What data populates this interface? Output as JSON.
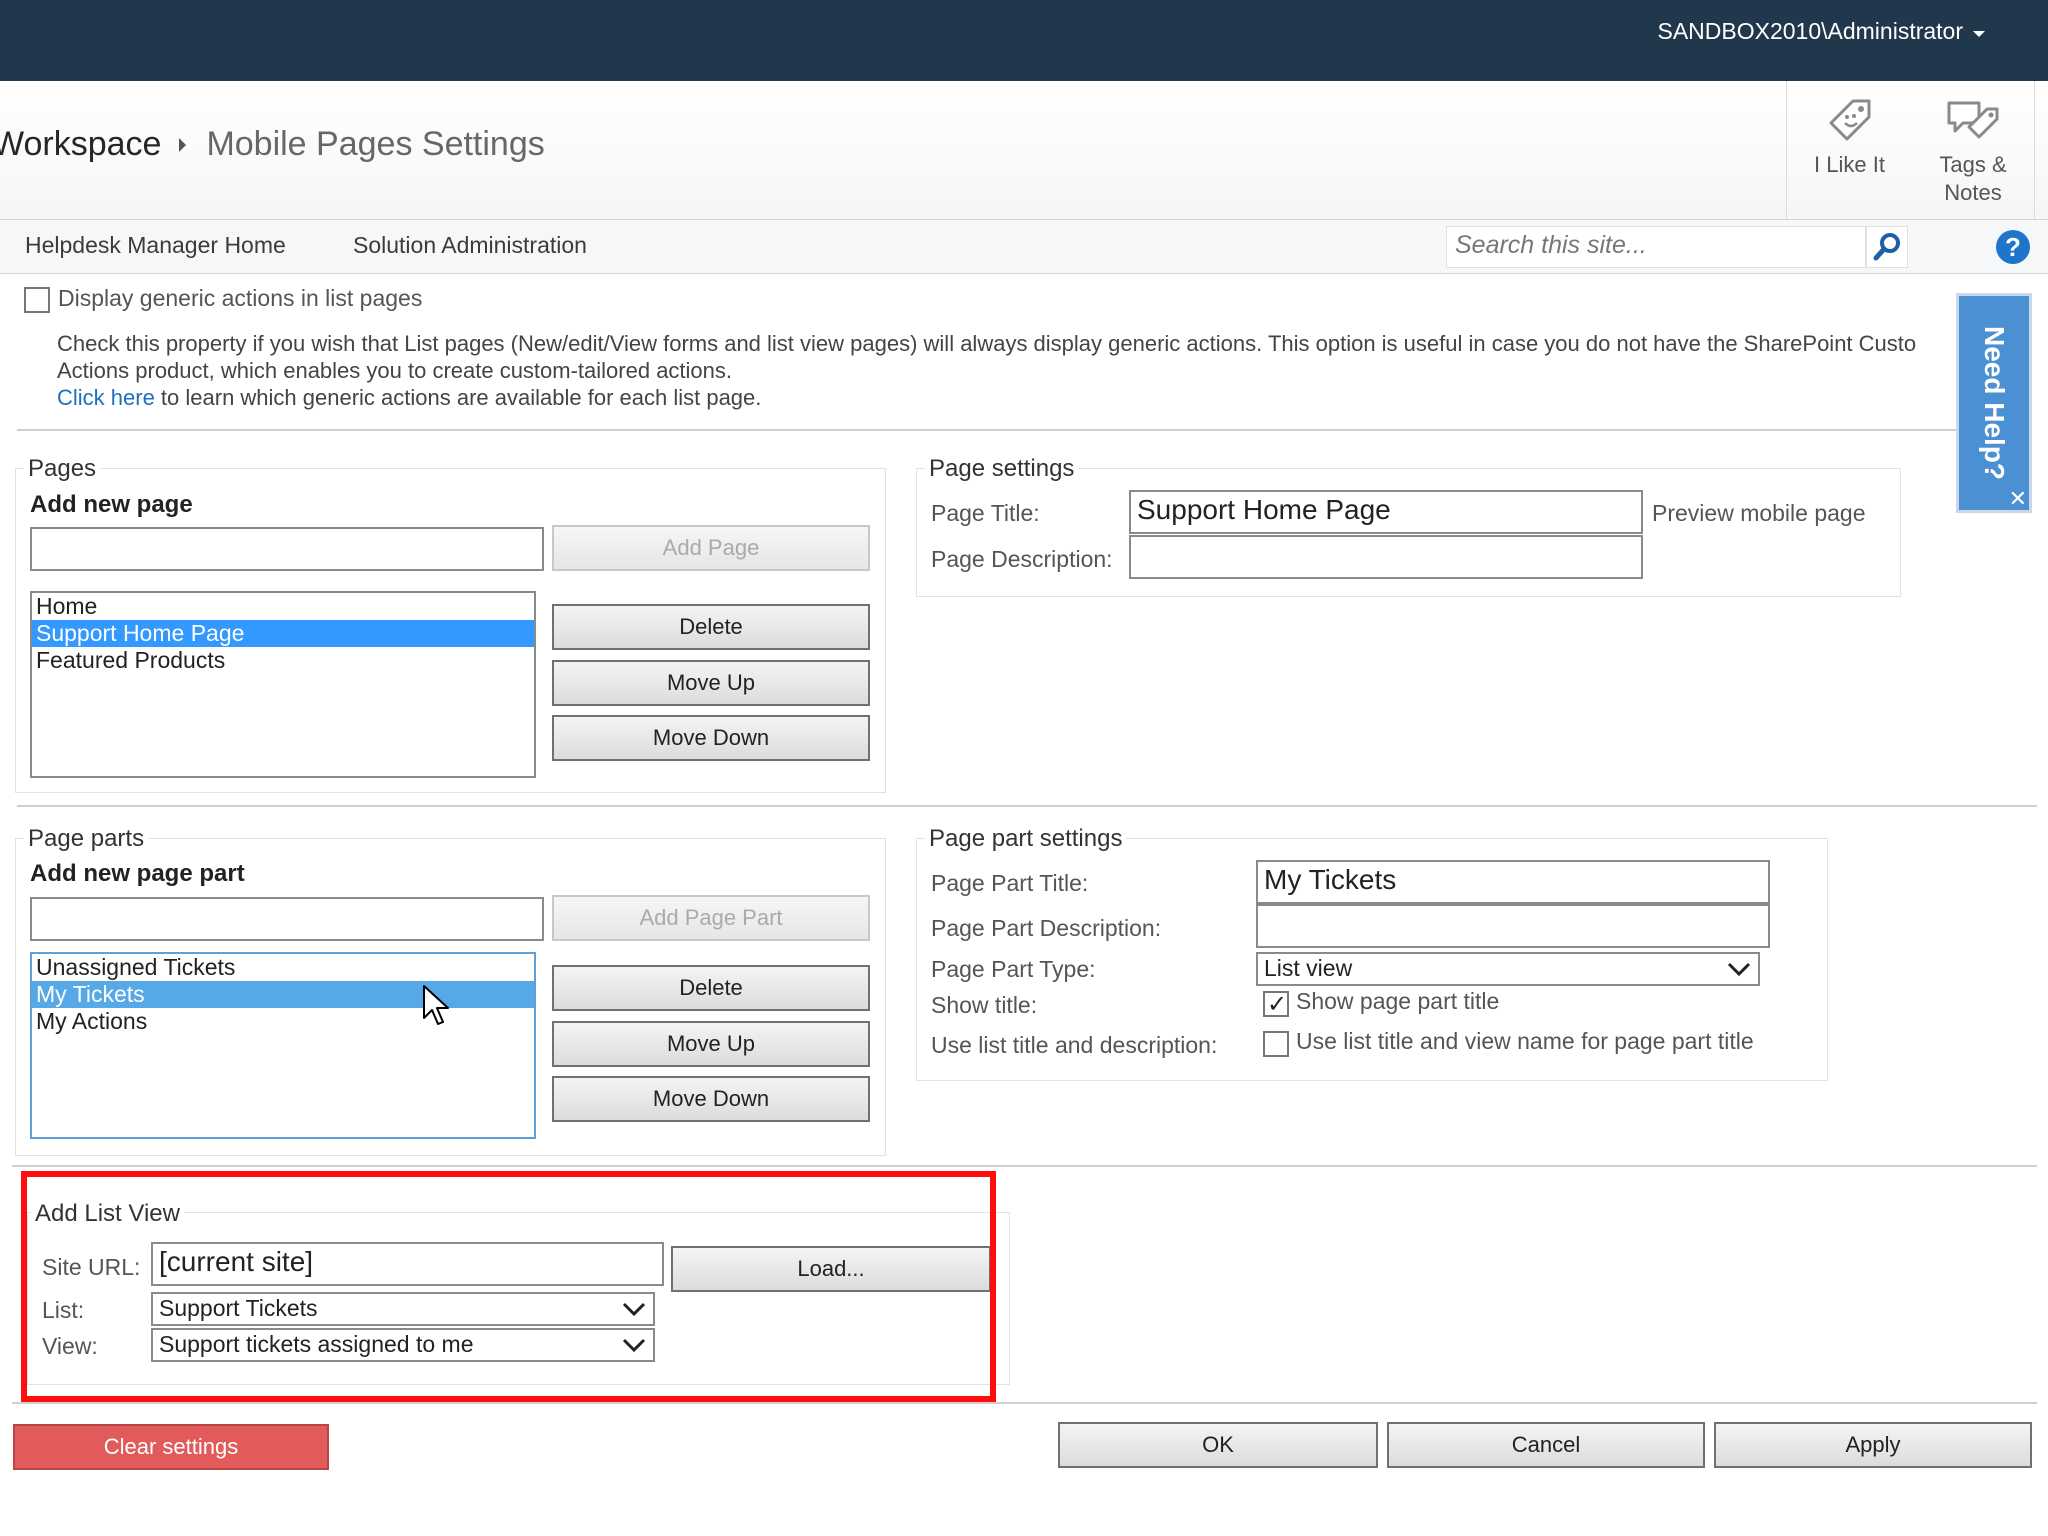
{
  "topbar": {
    "user": "SANDBOX2010\\Administrator"
  },
  "breadcrumb": {
    "parent": "Workspace",
    "current": "Mobile Pages Settings"
  },
  "social": {
    "like": "I Like It",
    "tags_line1": "Tags &",
    "tags_line2": "Notes"
  },
  "nav": {
    "home": "Helpdesk Manager Home",
    "admin": "Solution Administration"
  },
  "search": {
    "placeholder": "Search this site..."
  },
  "help_icon": "?",
  "generic": {
    "checkbox_label": "Display generic actions in list pages",
    "line1": "Check this property if you wish that List pages (New/edit/View forms and list view pages) will always display generic actions. This option is useful in case you do not have the SharePoint Custo",
    "line2": "Actions product, which enables you to create custom-tailored actions.",
    "link": "Click here",
    "line3_rest": " to learn which generic actions are available for each list page."
  },
  "pages": {
    "legend": "Pages",
    "add_heading": "Add new page",
    "add_button": "Add Page",
    "items": [
      "Home",
      "Support Home Page",
      "Featured Products"
    ],
    "delete": "Delete",
    "move_up": "Move Up",
    "move_down": "Move Down"
  },
  "page_settings": {
    "legend": "Page settings",
    "title_label": "Page Title:",
    "title_value": "Support Home Page",
    "preview_link": "Preview mobile page",
    "desc_label": "Page Description:"
  },
  "page_parts": {
    "legend": "Page parts",
    "add_heading": "Add new page part",
    "add_button": "Add Page Part",
    "items": [
      "Unassigned Tickets",
      "My Tickets",
      "My Actions"
    ],
    "delete": "Delete",
    "move_up": "Move Up",
    "move_down": "Move Down"
  },
  "part_settings": {
    "legend": "Page part settings",
    "title_label": "Page Part Title:",
    "title_value": "My Tickets",
    "desc_label": "Page Part Description:",
    "type_label": "Page Part Type:",
    "type_value": "List view",
    "show_title_label": "Show title:",
    "show_title_check": "Show page part title",
    "use_list_label": "Use list title and description:",
    "use_list_check": "Use list title and view name for page part title"
  },
  "list_view": {
    "legend": "Add List View",
    "site_url_label": "Site URL:",
    "site_url_value": "[current site]",
    "load_button": "Load...",
    "list_label": "List:",
    "list_value": "Support Tickets",
    "view_label": "View:",
    "view_value": "Support tickets assigned to me"
  },
  "need_help": {
    "label": "Need Help?",
    "close": "✕"
  },
  "footer": {
    "clear": "Clear settings",
    "ok": "OK",
    "cancel": "Cancel",
    "apply": "Apply"
  },
  "colors": {
    "topbar": "#21374c",
    "selection": "#3399ff",
    "highlight": "#ff0d0d",
    "danger": "#e15b5b",
    "link": "#1f6fbf"
  }
}
